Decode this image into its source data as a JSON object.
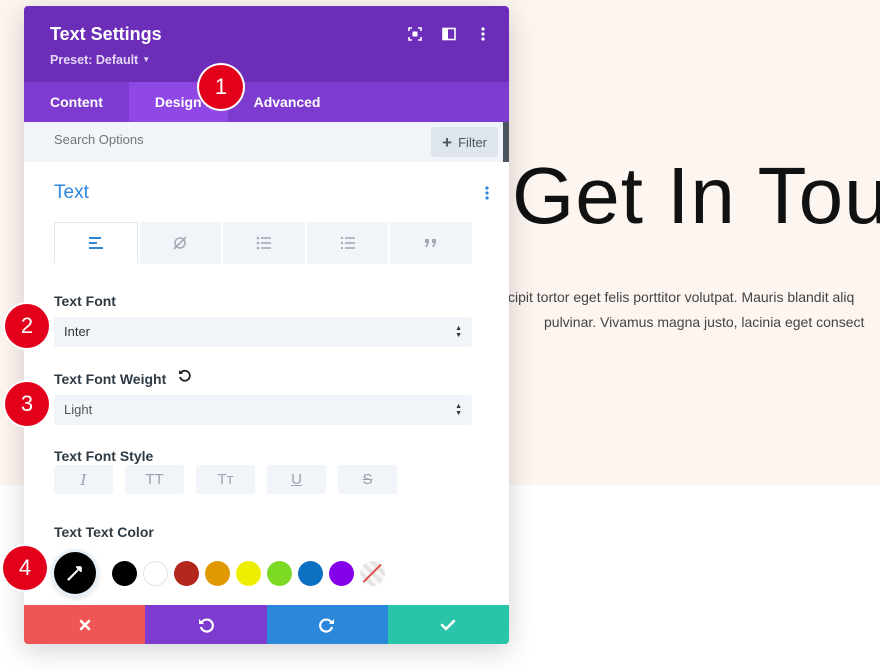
{
  "hero": {
    "title": "Get In Tou",
    "line1": "cipit tortor eget felis porttitor volutpat. Mauris blandit aliq",
    "line2": "pulvinar. Vivamus magna justo, lacinia eget consect"
  },
  "modal": {
    "title": "Text Settings",
    "preset": "Preset: Default",
    "header_icons": [
      "fullscreen-icon",
      "split-view-icon",
      "more-vertical-icon"
    ]
  },
  "tabs": [
    {
      "label": "Content",
      "active": false
    },
    {
      "label": "Design",
      "active": true
    },
    {
      "label": "Advanced",
      "active": false
    }
  ],
  "search": {
    "placeholder": "Search Options",
    "filter_label": "Filter"
  },
  "section": {
    "title": "Text",
    "subtabs": [
      "align-left-icon",
      "link-slash-icon",
      "bullet-list-icon",
      "numbered-list-icon",
      "quote-icon"
    ]
  },
  "fields": {
    "font_label": "Text Font",
    "font_value": "Inter",
    "weight_label": "Text Font Weight",
    "weight_value": "Light",
    "style_label": "Text Font Style",
    "style_buttons": [
      "I",
      "TT",
      "Tт",
      "U",
      "S"
    ],
    "color_label": "Text Text Color"
  },
  "colors": {
    "picker": "#000000",
    "swatches": [
      "#000000",
      "#ffffff",
      "#b3261e",
      "#e09900",
      "#eeee00",
      "#7cda24",
      "#0c71c3",
      "#8300e9",
      "transparent"
    ]
  },
  "footer": {
    "cancel_color": "#ef5555",
    "undo_color": "#7e3bd0",
    "redo_color": "#2b87da",
    "save_color": "#29c4a9"
  },
  "badges": [
    "1",
    "2",
    "3",
    "4"
  ],
  "theme": {
    "header": "#6c2eb9",
    "tabs": "#7e3bd0",
    "active_tab": "#8f47e6",
    "accent": "#2b87da"
  }
}
